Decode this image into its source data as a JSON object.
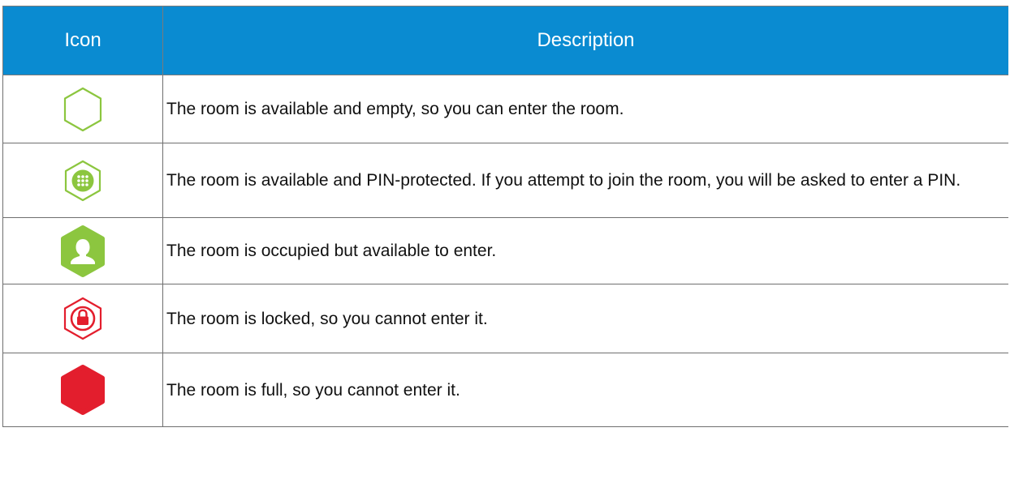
{
  "table": {
    "headers": {
      "icon": "Icon",
      "description": "Description"
    },
    "rows": [
      {
        "icon": "hexagon-outline-green-icon",
        "description": "The room is available and empty, so you can enter the room."
      },
      {
        "icon": "hexagon-keypad-green-icon",
        "description": "The room is available and PIN-protected. If you attempt to join the room, you will be asked to enter a PIN."
      },
      {
        "icon": "hexagon-user-green-icon",
        "description": "The room is occupied but available to enter."
      },
      {
        "icon": "hexagon-lock-red-icon",
        "description": "The room is locked, so you cannot enter it."
      },
      {
        "icon": "hexagon-solid-red-icon",
        "description": "The room is full, so you cannot enter it."
      }
    ]
  },
  "colors": {
    "header_background": "#0a8bd1",
    "header_text": "#ffffff",
    "available_green": "#8cc63f",
    "unavailable_red": "#e31e2d"
  }
}
